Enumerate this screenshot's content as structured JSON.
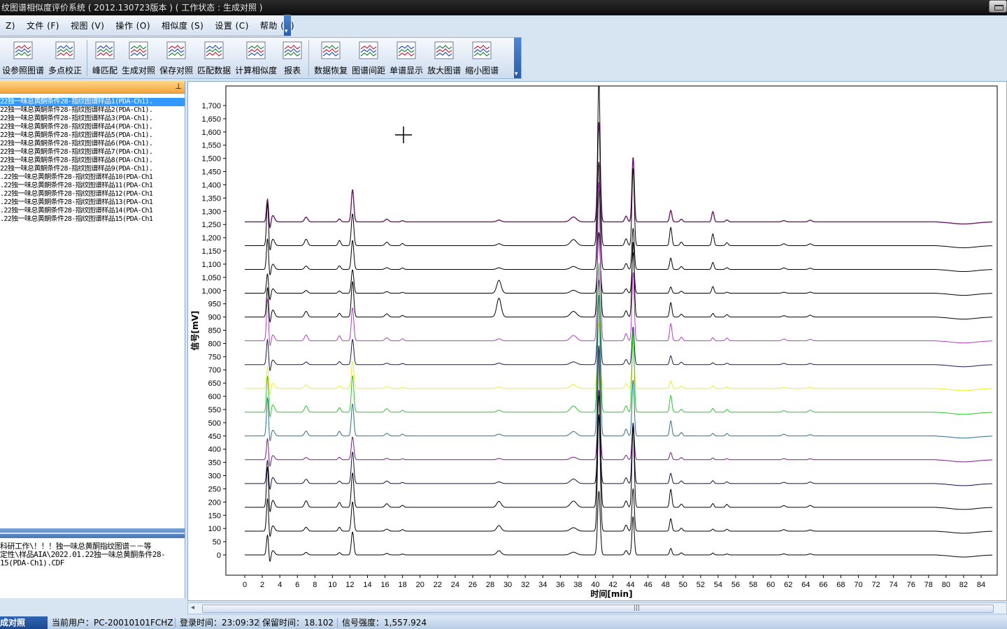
{
  "window": {
    "title": "纹图谱相似度评价系统 ( 2012.130723版本 ) ( 工作状态 : 生成对照 )"
  },
  "menu": {
    "items": [
      "Z)",
      "文件 (F)",
      "视图 (V)",
      "操作 (O)",
      "相似度 (S)",
      "设置 (C)",
      "帮助 (H)"
    ]
  },
  "toolbar": {
    "groups": [
      [
        {
          "label": "设参照图谱",
          "icon": "reference-spectrum-icon"
        },
        {
          "label": "多点校正",
          "icon": "multipoint-correction-icon"
        }
      ],
      [
        {
          "label": "峰匹配",
          "icon": "peak-match-icon"
        },
        {
          "label": "生成对照",
          "icon": "generate-reference-icon"
        },
        {
          "label": "保存对照",
          "icon": "save-reference-icon"
        },
        {
          "label": "匹配数据",
          "icon": "match-data-icon"
        },
        {
          "label": "计算相似度",
          "icon": "calc-similarity-icon"
        },
        {
          "label": "报表",
          "icon": "report-icon"
        }
      ],
      [
        {
          "label": "数据恢复",
          "icon": "data-restore-icon"
        },
        {
          "label": "图谱间距",
          "icon": "spectrum-spacing-icon"
        },
        {
          "label": "单谱显示",
          "icon": "single-spectrum-icon"
        },
        {
          "label": "放大图谱",
          "icon": "zoom-in-spectrum-icon"
        },
        {
          "label": "缩小图谱",
          "icon": "zoom-out-spectrum-icon"
        }
      ]
    ]
  },
  "sample_list": {
    "items": [
      "22独一味总黄酮条件28-指纹图谱样品1(PDA-Ch1).",
      "22独一味总黄酮条件28-指纹图谱样品2(PDA-Ch1).",
      "22独一味总黄酮条件28-指纹图谱样品3(PDA-Ch1).",
      "22独一味总黄酮条件28-指纹图谱样品4(PDA-Ch1).",
      "22独一味总黄酮条件28-指纹图谱样品5(PDA-Ch1).",
      "22独一味总黄酮条件28-指纹图谱样品6(PDA-Ch1).",
      "22独一味总黄酮条件28-指纹图谱样品7(PDA-Ch1).",
      "22独一味总黄酮条件28-指纹图谱样品8(PDA-Ch1).",
      "22独一味总黄酮条件28-指纹图谱样品9(PDA-Ch1).",
      ".22独一味总黄酮条件28-指纹图谱样品10(PDA-Ch1",
      ".22独一味总黄酮条件28-指纹图谱样品11(PDA-Ch1",
      ".22独一味总黄酮条件28-指纹图谱样品12(PDA-Ch1",
      ".22独一味总黄酮条件28-指纹图谱样品13(PDA-Ch1",
      ".22独一味总黄酮条件28-指纹图谱样品14(PDA-Ch1",
      ".22独一味总黄酮条件28-指纹图谱样品15(PDA-Ch1"
    ],
    "selected_index": 0
  },
  "info_panel": {
    "text": "科研工作\\！！！独一味总黄酮指纹图谱－－等\n定性\\样品AIA\\2022.01.22独一味总黄酮条件28-\n15(PDA-Ch1).CDF"
  },
  "chart_data": {
    "type": "line",
    "ylabel": "信号[mV]",
    "xlabel": "时间[min]",
    "xlim": [
      0,
      85
    ],
    "ylim": [
      -40,
      1740
    ],
    "x_ticks": [
      0,
      2,
      4,
      6,
      8,
      10,
      12,
      14,
      16,
      18,
      20,
      22,
      24,
      26,
      28,
      30,
      32,
      34,
      36,
      38,
      40,
      42,
      44,
      46,
      48,
      50,
      52,
      54,
      56,
      58,
      60,
      62,
      64,
      66,
      68,
      70,
      72,
      74,
      76,
      78,
      80,
      82,
      84
    ],
    "y_ticks": [
      0,
      50,
      100,
      150,
      200,
      250,
      300,
      350,
      400,
      450,
      500,
      550,
      600,
      650,
      700,
      750,
      800,
      850,
      900,
      950,
      1000,
      1050,
      1100,
      1150,
      1200,
      1250,
      1300,
      1350,
      1400,
      1450,
      1500,
      1550,
      1600,
      1650,
      1700
    ],
    "series_offsets": [
      1260,
      1170,
      1080,
      990,
      900,
      810,
      720,
      630,
      540,
      450,
      360,
      270,
      180,
      90,
      0
    ],
    "series_colors": [
      "#6a1a66",
      "#000000",
      "#000000",
      "#000000",
      "#000000",
      "#b43cc8",
      "#1a1a55",
      "#f0f020",
      "#28c828",
      "#2a6f8a",
      "#7a1a8a",
      "#101040",
      "#000000",
      "#000000",
      "#000000"
    ],
    "peaks": [
      {
        "rt": 2.6,
        "height": 130,
        "width": 0.12
      },
      {
        "rt": 3.2,
        "height": 25,
        "width": 0.2
      },
      {
        "rt": 7.0,
        "height": 18,
        "width": 0.18
      },
      {
        "rt": 10.8,
        "height": 15,
        "width": 0.15
      },
      {
        "rt": 12.3,
        "height": 130,
        "width": 0.14
      },
      {
        "rt": 16.2,
        "height": 10,
        "width": 0.2
      },
      {
        "rt": 18.0,
        "height": 6,
        "width": 0.15
      },
      {
        "rt": 29.0,
        "height": 12,
        "width": 0.25
      },
      {
        "rt": 37.5,
        "height": 18,
        "width": 0.35
      },
      {
        "rt": 40.4,
        "height": 460,
        "width": 0.15
      },
      {
        "rt": 43.5,
        "height": 25,
        "width": 0.15
      },
      {
        "rt": 44.3,
        "height": 240,
        "width": 0.13
      },
      {
        "rt": 48.6,
        "height": 50,
        "width": 0.13
      },
      {
        "rt": 49.8,
        "height": 12,
        "width": 0.15
      },
      {
        "rt": 53.4,
        "height": 38,
        "width": 0.13
      },
      {
        "rt": 55.0,
        "height": 8,
        "width": 0.15
      },
      {
        "rt": 61.5,
        "height": 6,
        "width": 0.2
      },
      {
        "rt": 64.5,
        "height": 6,
        "width": 0.2
      }
    ],
    "grid": false,
    "legend": "none"
  },
  "status": {
    "mode": "成对照",
    "user": "当前用户：PC-20010101FCHZ",
    "login": "登录时间：23:09:32",
    "retention": "保留时间：18.102",
    "signal": "信号强度：1,557.924"
  }
}
